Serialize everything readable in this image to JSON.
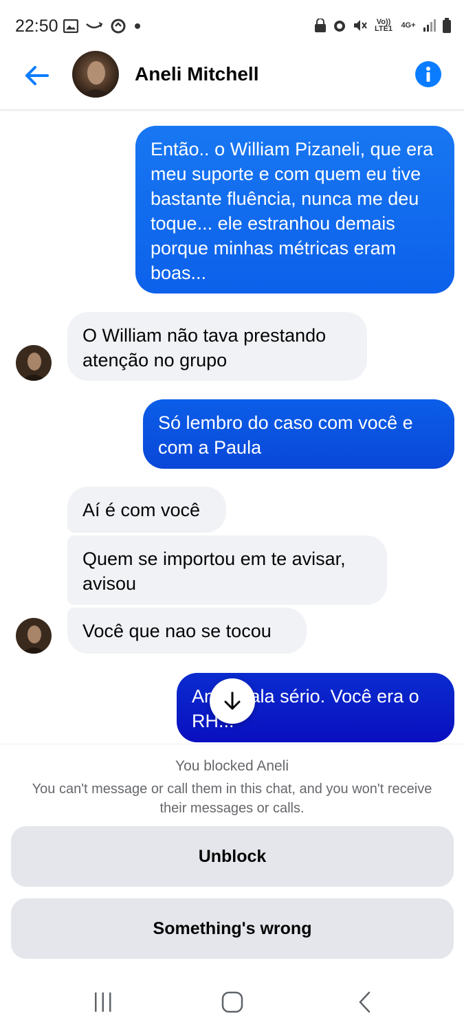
{
  "status_bar": {
    "time": "22:50",
    "left_icons": [
      "image-icon",
      "amazon-smile-icon",
      "sync-icon",
      "dot-icon"
    ],
    "right_icons": [
      "lock-icon",
      "alarm-icon",
      "mute-icon",
      "volte-icon",
      "4g-icon",
      "signal-icon",
      "battery-icon"
    ],
    "volte_label": "Vo)) LTE1",
    "net_label": "4G+"
  },
  "header": {
    "contact_name": "Aneli Mitchell",
    "back_icon": "arrow-left-icon",
    "info_icon": "info-icon",
    "accent_color": "#0a7cff"
  },
  "messages": [
    {
      "direction": "outgoing",
      "text": "Então.. o William Pizaneli, que era meu suporte e com quem eu tive bastante fluência, nunca me deu toque... ele estranhou demais porque minhas métricas eram boas..."
    },
    {
      "direction": "incoming",
      "text": "O William não tava prestando atenção no grupo"
    },
    {
      "direction": "outgoing",
      "text": "Só lembro do caso com você e com a Paula"
    },
    {
      "direction": "incoming",
      "text": "Aí é com você"
    },
    {
      "direction": "incoming",
      "text": "Quem se importou em te avisar, avisou"
    },
    {
      "direction": "incoming",
      "text": "Você que nao se tocou"
    },
    {
      "direction": "outgoing",
      "text_line1_start": "An",
      "text_line1_end": "fala sério. Você era o",
      "text_line2": "RH..."
    }
  ],
  "blocked": {
    "title": "You blocked Aneli",
    "description": "You can't message or call them in this chat, and you won't receive their messages or calls.",
    "unblock_label": "Unblock",
    "wrong_label": "Something's wrong"
  },
  "nav": {
    "recents_icon": "recents-icon",
    "home_icon": "home-icon",
    "back_icon": "back-chevron-icon"
  },
  "colors": {
    "outgoing_top": "#1877f2",
    "outgoing_mid": "#0b5ee8",
    "outgoing_bottom": "#0a0fbf",
    "incoming_bg": "#f0f2f5",
    "button_bg": "#e4e6eb"
  }
}
